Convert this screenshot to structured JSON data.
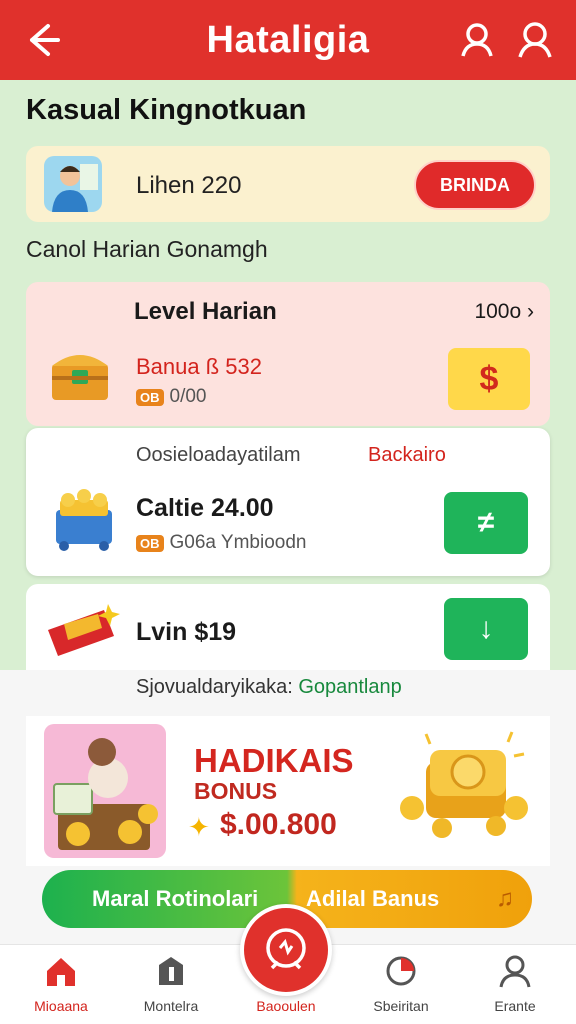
{
  "header": {
    "title": "Hataligia"
  },
  "section_title": "Kasual Kingnotkuan",
  "user_card": {
    "text": "Lihen 220",
    "button_label": "BRINDA"
  },
  "subsection_title": "Canol Harian Gonamgh",
  "level_card": {
    "title": "Level Harian",
    "right_value": "100o",
    "chevron": "›",
    "bonus_text": "Banua ß 532",
    "tag": "OB",
    "sub_value": "0/00",
    "button_symbol": "$"
  },
  "white_card": {
    "header": "Oosieloadayatilam",
    "link": "Backairo",
    "title": "Caltie 24.00",
    "tag": "OB",
    "sub": "G06a Ymbioodn",
    "button_symbol": "≠"
  },
  "win_card": {
    "title": "Lvin $19",
    "button_symbol": "↓"
  },
  "promo": {
    "text": "Sjovualdaryikaka:",
    "highlight": "Gopantlanp"
  },
  "bonus": {
    "title": "HADIKAIS",
    "subtitle": "BONUS",
    "amount": "$.00.800",
    "star": "✦"
  },
  "gradient_button": {
    "left_label": "Maral Rotinolari",
    "right_label": "Adilal Banus",
    "note": "♫"
  },
  "bottom_nav": {
    "items": [
      {
        "label": "Mioaana"
      },
      {
        "label": "Montelra"
      },
      {
        "label": "Baooulen"
      },
      {
        "label": "Sbeiritan"
      },
      {
        "label": "Erante"
      }
    ]
  },
  "colors": {
    "primary": "#e0312c",
    "background": "#d9efd2",
    "accent_green": "#1fb45a",
    "accent_yellow": "#ffd84a"
  }
}
